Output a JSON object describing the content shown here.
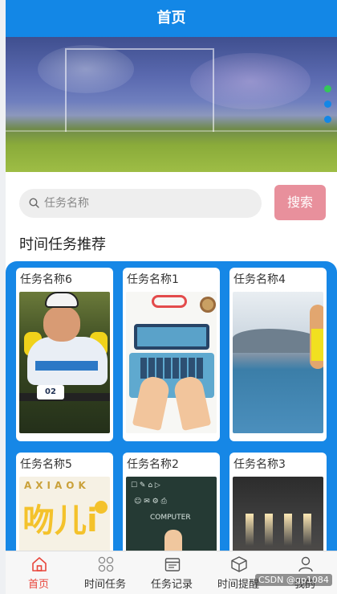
{
  "header": {
    "title": "首页"
  },
  "banner": {
    "indicator_colors": [
      "#34c759",
      "#1387e6",
      "#1387e6"
    ]
  },
  "search": {
    "placeholder": "任务名称",
    "button_label": "搜索",
    "button_color": "#e8909c"
  },
  "section": {
    "title": "时间任务推荐"
  },
  "tasks": [
    {
      "title": "任务名称6",
      "image": "cyclist-photo"
    },
    {
      "title": "任务名称1",
      "image": "laptop-illustration"
    },
    {
      "title": "任务名称4",
      "image": "runner-photo"
    },
    {
      "title": "任务名称5",
      "image": "poster-photo"
    },
    {
      "title": "任务名称2",
      "image": "chalkboard-photo"
    },
    {
      "title": "任务名称3",
      "image": "hall-photo"
    }
  ],
  "poster": {
    "brand": "AXIAOK"
  },
  "tabbar": {
    "items": [
      {
        "label": "首页",
        "icon": "home-icon",
        "active": true
      },
      {
        "label": "时间任务",
        "icon": "grid-icon",
        "active": false
      },
      {
        "label": "任务记录",
        "icon": "calendar-icon",
        "active": false
      },
      {
        "label": "时间提醒",
        "icon": "box-icon",
        "active": false
      },
      {
        "label": "我的",
        "icon": "user-icon",
        "active": false
      }
    ]
  },
  "watermark": "CSDN @gp1084",
  "colors": {
    "primary": "#1387e6",
    "active_tab": "#e8463c"
  }
}
